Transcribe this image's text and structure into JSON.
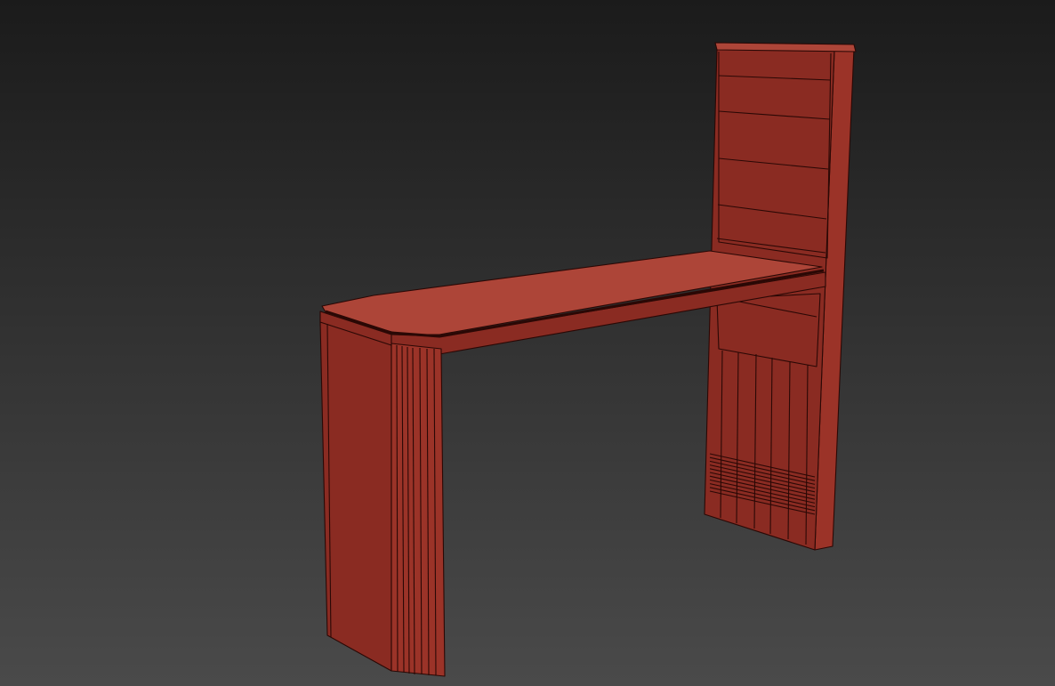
{
  "viewport": {
    "background_top": "#1b1b1b",
    "background_bottom": "#4a4a4a",
    "model": {
      "name": "bar-table-with-back-panel",
      "colors": {
        "face": "#8a2b22",
        "face_light": "#ad4538",
        "face_mid": "#9b3328",
        "face_dark": "#6e1f18",
        "edge": "#2a0805"
      }
    }
  }
}
